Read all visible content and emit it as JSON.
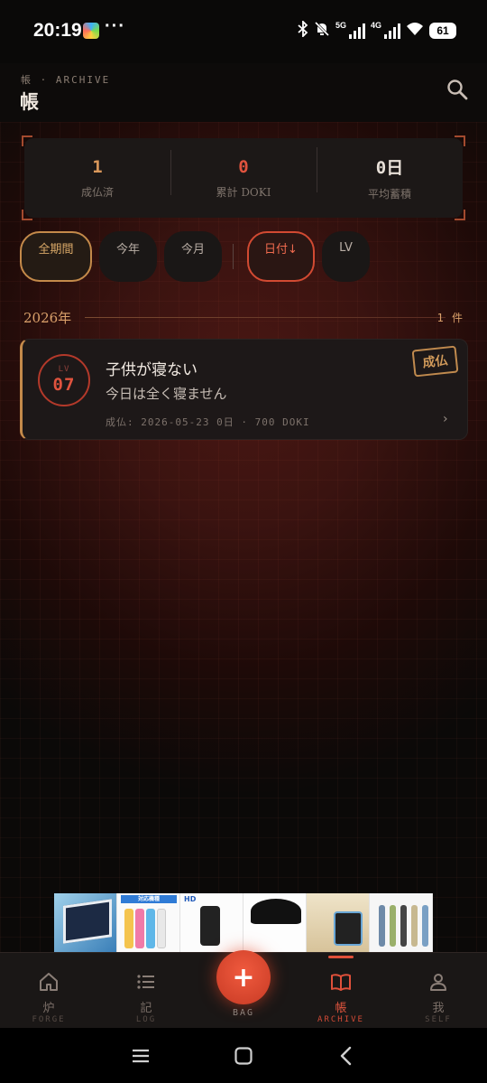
{
  "status_bar": {
    "time": "20:19",
    "dots": "···",
    "network_1": "5G",
    "network_2": "4G",
    "battery": "61"
  },
  "header": {
    "subtitle": "帳 · ARCHIVE",
    "title": "帳",
    "search_icon": "search-icon"
  },
  "stats": [
    {
      "value": "1",
      "label": "成仏済",
      "color": "#d9975a"
    },
    {
      "value": "0",
      "label": "累計 DOKI",
      "color": "#e0533e"
    },
    {
      "value": "0日",
      "label": "平均蓄積",
      "color": "#e8e0d8"
    }
  ],
  "filters": {
    "period": [
      {
        "label": "全期間",
        "active": true
      },
      {
        "label": "今年",
        "active": false
      },
      {
        "label": "今月",
        "active": false
      }
    ],
    "sort": [
      {
        "label": "日付↓",
        "active": true
      },
      {
        "label": "LV",
        "active": false
      }
    ]
  },
  "year_group": {
    "year": "2026年",
    "count": "1 件"
  },
  "records": [
    {
      "lv_label": "LV",
      "lv": "07",
      "title": "子供が寝ない",
      "subtitle": "今日は全く寝ません",
      "meta": "成仏: 2026-05-23 0日 · 700 DOKI",
      "stamp": "成仏",
      "chevron": "›"
    }
  ],
  "ad_banner": {
    "texts": [
      "対応機種",
      "HD"
    ]
  },
  "bottom_nav": {
    "items": [
      {
        "kanji": "炉",
        "en": "FORGE",
        "icon": "home-icon"
      },
      {
        "kanji": "記",
        "en": "LOG",
        "icon": "list-icon"
      },
      {
        "kanji": "帳",
        "en": "ARCHIVE",
        "icon": "book-icon",
        "active": true
      },
      {
        "kanji": "我",
        "en": "SELF",
        "icon": "person-icon"
      }
    ],
    "fab_symbol": "+",
    "fab_label": "BAG"
  },
  "system_nav": {
    "icons": [
      "menu-icon",
      "home-square-icon",
      "back-icon"
    ]
  }
}
